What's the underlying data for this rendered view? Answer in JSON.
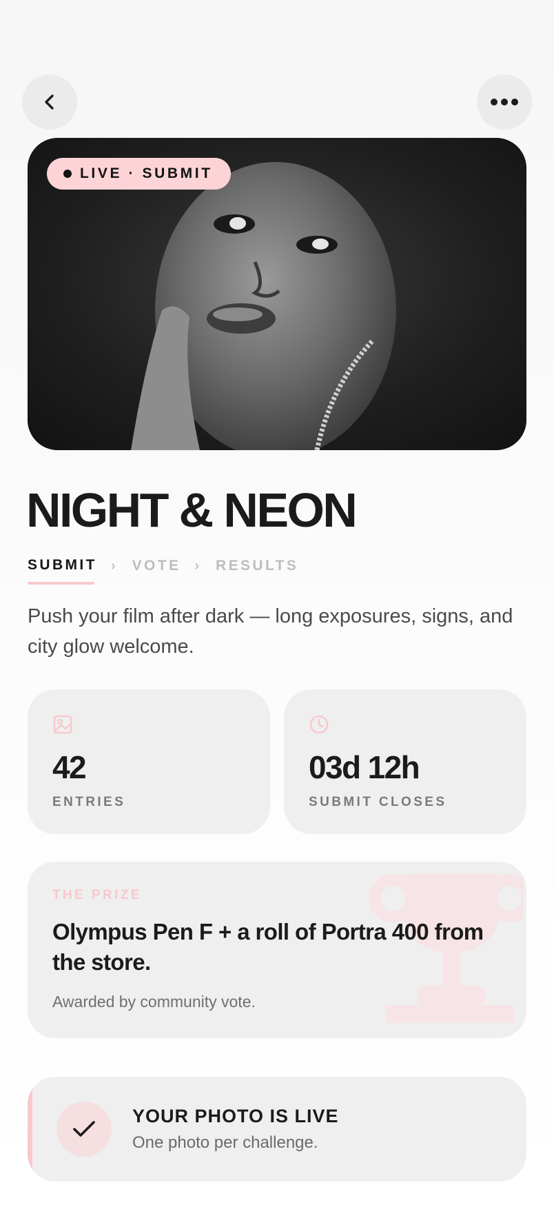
{
  "nav": {
    "back_icon": "chevron-left-icon",
    "more_icon": "ellipsis-icon"
  },
  "hero": {
    "badge": "LIVE · SUBMIT",
    "image_desc": "black-and-white portrait photo"
  },
  "challenge": {
    "title": "NIGHT & NEON",
    "description": "Push your film after dark — long exposures, signs, and city glow welcome."
  },
  "steps": [
    {
      "label": "SUBMIT",
      "active": true
    },
    {
      "label": "VOTE",
      "active": false
    },
    {
      "label": "RESULTS",
      "active": false
    }
  ],
  "stats": {
    "entries": {
      "value": "42",
      "label": "ENTRIES",
      "icon": "image-icon"
    },
    "closes": {
      "value": "03d 12h",
      "label": "SUBMIT CLOSES",
      "icon": "clock-icon"
    }
  },
  "prize": {
    "label": "THE PRIZE",
    "text": "Olympus Pen F + a roll of Portra 400 from the store.",
    "sub": "Awarded by community vote.",
    "icon": "trophy-icon"
  },
  "status": {
    "title": "YOUR PHOTO IS LIVE",
    "sub": "One photo per challenge.",
    "icon": "check-icon"
  },
  "colors": {
    "accent_pink": "#fcd3d6",
    "card_bg": "#efefef",
    "text_dark": "#1b1b1b"
  }
}
